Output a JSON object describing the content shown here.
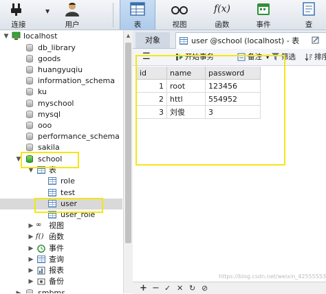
{
  "toolbar": {
    "buttons": [
      {
        "label": "连接",
        "icon": "plug-icon"
      },
      {
        "label": "用户",
        "icon": "user-icon"
      },
      {
        "label": "表",
        "icon": "table-icon",
        "active": true
      },
      {
        "label": "视图",
        "icon": "glasses-icon"
      },
      {
        "label": "函数",
        "icon": "function-icon",
        "glyph": "f(x)"
      },
      {
        "label": "事件",
        "icon": "event-icon"
      },
      {
        "label": "查",
        "icon": "query-icon"
      }
    ]
  },
  "tree": {
    "connection": "localhost",
    "databases": [
      "db_library",
      "goods",
      "huangyuqiu",
      "information_schema",
      "ku",
      "myschool",
      "mysql",
      "ooo",
      "performance_schema",
      "sakila"
    ],
    "open_database": "school",
    "tables_group": "表",
    "tables": [
      "role",
      "test",
      "user",
      "user_role"
    ],
    "selected_table": "user",
    "groups": [
      "视图",
      "函数",
      "事件",
      "查询",
      "报表",
      "备份"
    ],
    "group_glyphs": {
      "function": "f()"
    },
    "next_database": "smbms"
  },
  "tabs": {
    "objects_label": "对象",
    "active_tab_label": "user @school (localhost) - 表",
    "overflow_icon": "tab-overflow-icon"
  },
  "grid_toolbar": {
    "menu_glyph": "☰",
    "begin_transaction": "开始事务",
    "note": "备注",
    "filter": "筛选",
    "sort": "排序"
  },
  "grid": {
    "columns": [
      "id",
      "name",
      "password"
    ],
    "rows": [
      {
        "id": "1",
        "name": "root",
        "password": "123456"
      },
      {
        "id": "2",
        "name": "httl",
        "password": "554952"
      },
      {
        "id": "3",
        "name": "刘俊",
        "password": "3"
      }
    ],
    "current_row_index": 1
  },
  "bottom_bar": {
    "add": "+",
    "delete": "−",
    "apply": "✓",
    "cancel": "✕",
    "refresh": "↻",
    "stop": "⊘"
  },
  "watermark": "https://blog.csdn.net/weixin_42555553",
  "colors": {
    "highlight": "#f5e612",
    "toolbar_active": "#aecbeb",
    "selected_row": "#d9d9d9",
    "db_active": "#2f9d25"
  }
}
